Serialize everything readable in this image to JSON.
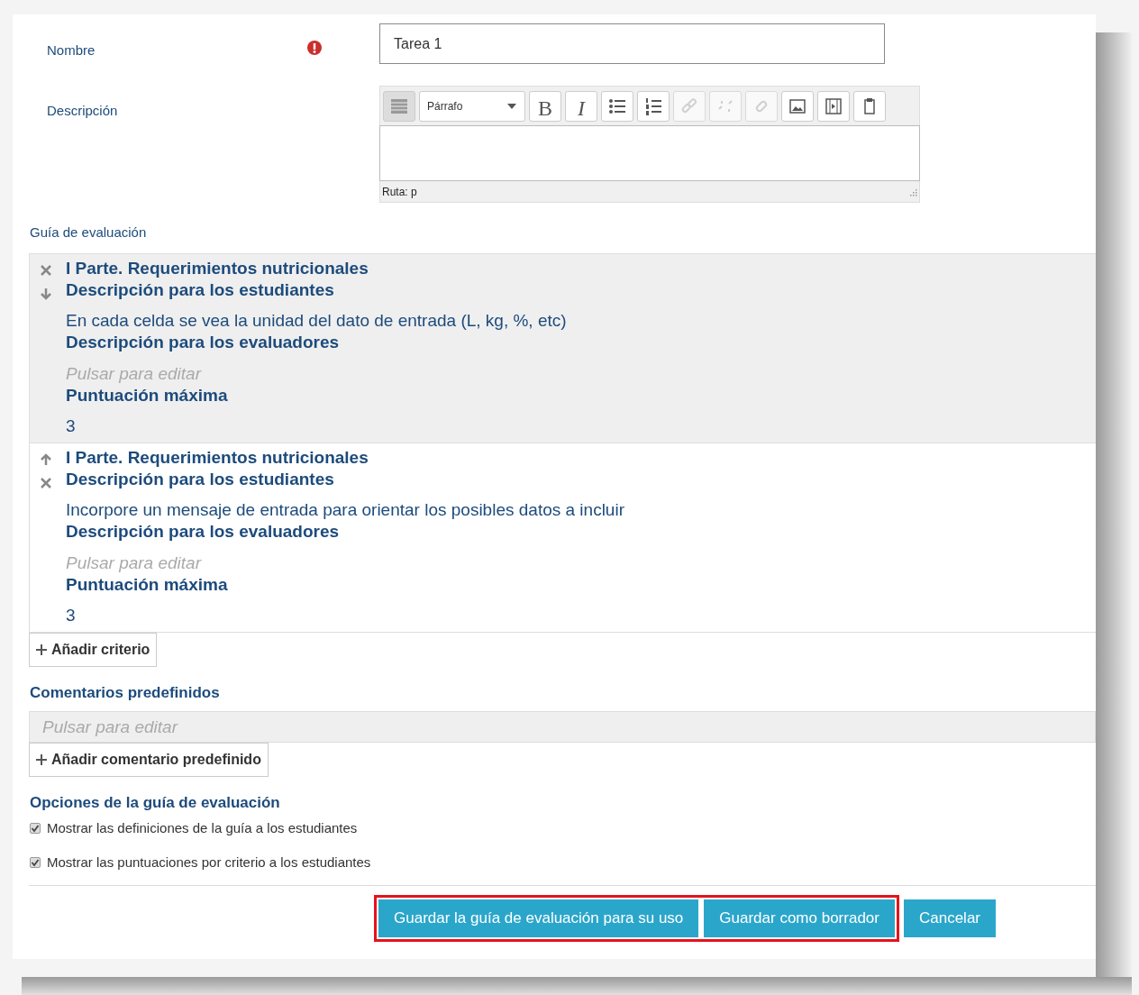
{
  "name_field": {
    "label": "Nombre",
    "required": true,
    "value": "Tarea 1"
  },
  "description_field": {
    "label": "Descripción",
    "path": "Ruta: p",
    "toolbar": [
      {
        "kind": "toggle"
      },
      {
        "kind": "format",
        "label": "Párrafo"
      },
      {
        "kind": "text",
        "label": "B",
        "disabled": false
      },
      {
        "kind": "text",
        "label": "I",
        "disabled": false
      },
      {
        "kind": "bullets",
        "disabled": false
      },
      {
        "kind": "numbers",
        "disabled": false
      },
      {
        "kind": "link",
        "disabled": true
      },
      {
        "kind": "unlink",
        "disabled": true
      },
      {
        "kind": "anchor",
        "disabled": true
      },
      {
        "kind": "image",
        "disabled": false
      },
      {
        "kind": "media",
        "disabled": false
      },
      {
        "kind": "paste",
        "disabled": false
      }
    ]
  },
  "rubric": {
    "label": "Guía de evaluación",
    "criteria": [
      {
        "highlighted": true,
        "can_move_up": false,
        "can_move_down": true,
        "title": "I Parte. Requerimientos nutricionales",
        "student_label": "Descripción para los estudiantes",
        "student_text": "En cada celda se vea la unidad del dato de entrada (L, kg, %, etc)",
        "marker_label": "Descripción para los evaluadores",
        "marker_placeholder": "Pulsar para editar",
        "max_label": "Puntuación máxima",
        "max_value": "3"
      },
      {
        "highlighted": false,
        "can_move_up": true,
        "can_move_down": false,
        "title": "I Parte. Requerimientos nutricionales",
        "student_label": "Descripción para los estudiantes",
        "student_text": "Incorpore un mensaje de entrada para orientar los posibles datos a incluir",
        "marker_label": "Descripción para los evaluadores",
        "marker_placeholder": "Pulsar para editar",
        "max_label": "Puntuación máxima",
        "max_value": "3"
      }
    ],
    "add_criterion": "Añadir criterio"
  },
  "comments": {
    "heading": "Comentarios predefinidos",
    "placeholder": "Pulsar para editar",
    "add_button": "Añadir comentario predefinido"
  },
  "options": {
    "heading": "Opciones de la guía de evaluación",
    "items": [
      {
        "label": "Mostrar las definiciones de la guía a los estudiantes",
        "checked": true
      },
      {
        "label": "Mostrar las puntuaciones por criterio a los estudiantes",
        "checked": true
      }
    ]
  },
  "footer_buttons": [
    {
      "label": "Guardar la guía de evaluación para su uso",
      "highlighted": true
    },
    {
      "label": "Guardar como borrador",
      "highlighted": true
    },
    {
      "label": "Cancelar",
      "highlighted": false
    }
  ]
}
